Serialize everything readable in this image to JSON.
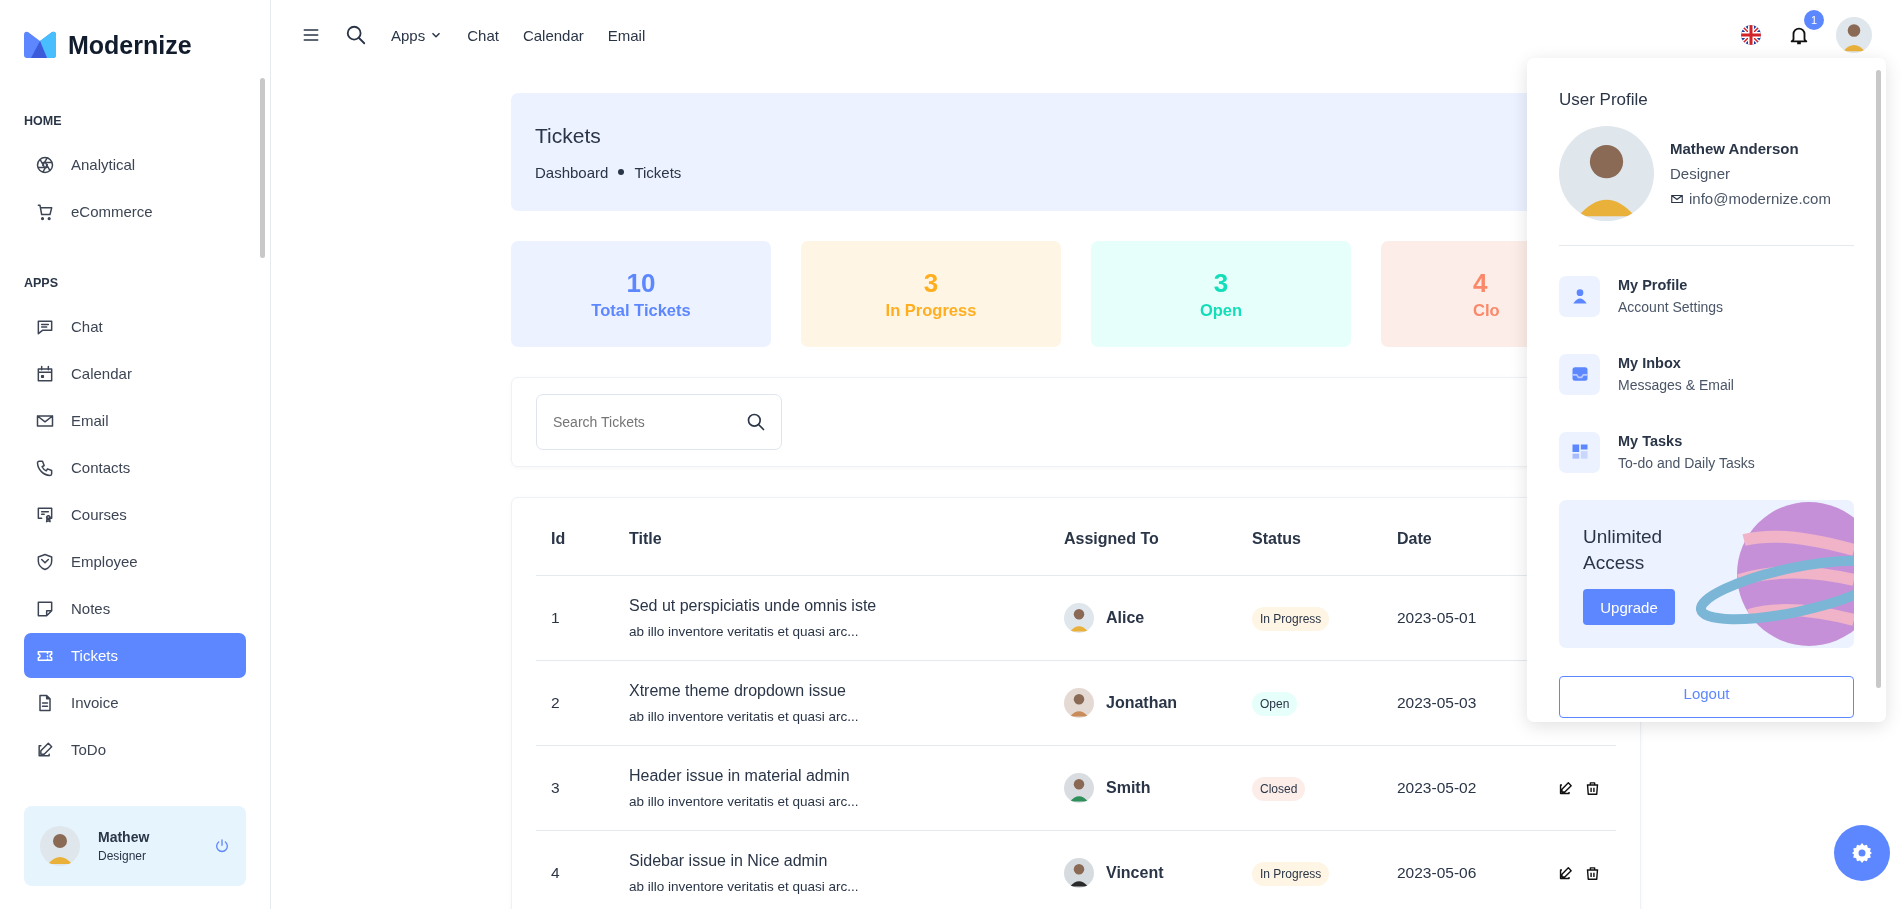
{
  "brand": {
    "name": "Modernize"
  },
  "sidebar": {
    "sections": [
      {
        "heading": "HOME",
        "items": [
          {
            "label": "Analytical",
            "selected": false
          },
          {
            "label": "eCommerce",
            "selected": false
          }
        ]
      },
      {
        "heading": "APPS",
        "items": [
          {
            "label": "Chat",
            "selected": false
          },
          {
            "label": "Calendar",
            "selected": false
          },
          {
            "label": "Email",
            "selected": false
          },
          {
            "label": "Contacts",
            "selected": false
          },
          {
            "label": "Courses",
            "selected": false
          },
          {
            "label": "Employee",
            "selected": false
          },
          {
            "label": "Notes",
            "selected": false
          },
          {
            "label": "Tickets",
            "selected": true
          },
          {
            "label": "Invoice",
            "selected": false
          },
          {
            "label": "ToDo",
            "selected": false
          }
        ]
      }
    ],
    "user": {
      "name": "Mathew",
      "role": "Designer"
    }
  },
  "topbar": {
    "links": [
      {
        "label": "Apps",
        "dropdown": true
      },
      {
        "label": "Chat",
        "dropdown": false
      },
      {
        "label": "Calendar",
        "dropdown": false
      },
      {
        "label": "Email",
        "dropdown": false
      }
    ],
    "notifications": "1"
  },
  "header": {
    "title": "Tickets",
    "breadcrumb": [
      "Dashboard",
      "Tickets"
    ]
  },
  "stats": [
    {
      "value": "10",
      "label": "Total Tickets",
      "kind": "total"
    },
    {
      "value": "3",
      "label": "In Progress",
      "kind": "progress"
    },
    {
      "value": "3",
      "label": "Open",
      "kind": "open"
    },
    {
      "value": "4",
      "label": "Clo",
      "kind": "closed"
    }
  ],
  "search": {
    "placeholder": "Search Tickets"
  },
  "table": {
    "columns": [
      "Id",
      "Title",
      "Assigned To",
      "Status",
      "Date"
    ],
    "rows": [
      {
        "id": "1",
        "title": "Sed ut perspiciatis unde omnis iste",
        "subtitle": "ab illo inventore veritatis et quasi arc...",
        "assignee": "Alice",
        "status": "In Progress",
        "kind": "progress",
        "date": "2023-05-01"
      },
      {
        "id": "2",
        "title": "Xtreme theme dropdown issue",
        "subtitle": "ab illo inventore veritatis et quasi arc...",
        "assignee": "Jonathan",
        "status": "Open",
        "kind": "open",
        "date": "2023-05-03"
      },
      {
        "id": "3",
        "title": "Header issue in material admin",
        "subtitle": "ab illo inventore veritatis et quasi arc...",
        "assignee": "Smith",
        "status": "Closed",
        "kind": "closed",
        "date": "2023-05-02"
      },
      {
        "id": "4",
        "title": "Sidebar issue in Nice admin",
        "subtitle": "ab illo inventore veritatis et quasi arc...",
        "assignee": "Vincent",
        "status": "In Progress",
        "kind": "progress",
        "date": "2023-05-06"
      }
    ]
  },
  "profile_menu": {
    "title": "User Profile",
    "name": "Mathew Anderson",
    "role": "Designer",
    "email": "info@modernize.com",
    "items": [
      {
        "title": "My Profile",
        "subtitle": "Account Settings"
      },
      {
        "title": "My Inbox",
        "subtitle": "Messages & Email"
      },
      {
        "title": "My Tasks",
        "subtitle": "To-do and Daily Tasks"
      }
    ],
    "promo": {
      "title": "Unlimited Access",
      "button": "Upgrade"
    },
    "logout": "Logout"
  }
}
